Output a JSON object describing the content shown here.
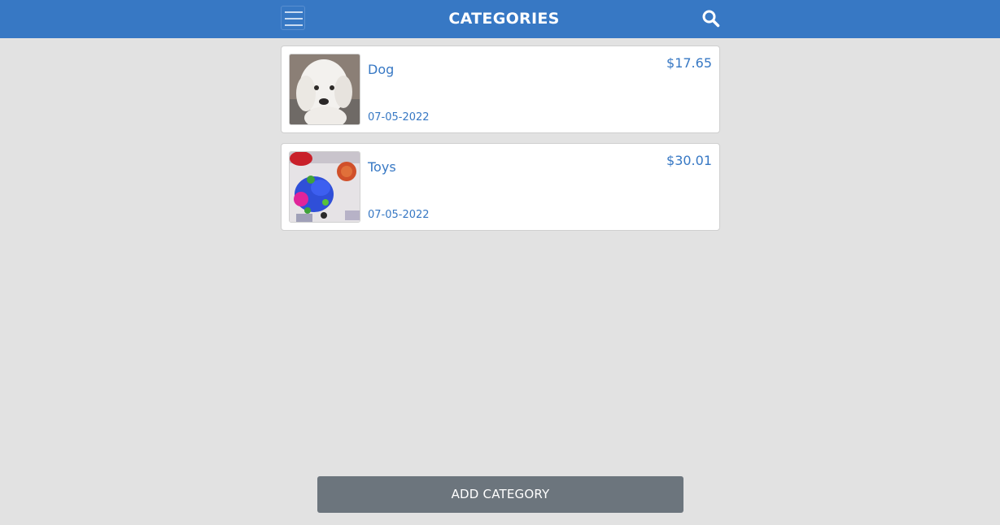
{
  "header": {
    "title": "CATEGORIES",
    "menu_icon": "hamburger-menu-icon",
    "search_icon": "search-icon",
    "bg_color": "#3778c4"
  },
  "categories": [
    {
      "name": "Dog",
      "date": "07-05-2022",
      "price": "$17.65",
      "image": "dog-photo"
    },
    {
      "name": "Toys",
      "date": "07-05-2022",
      "price": "$30.01",
      "image": "toys-photo"
    }
  ],
  "footer": {
    "add_label": "ADD CATEGORY",
    "button_color": "#6c757d"
  }
}
